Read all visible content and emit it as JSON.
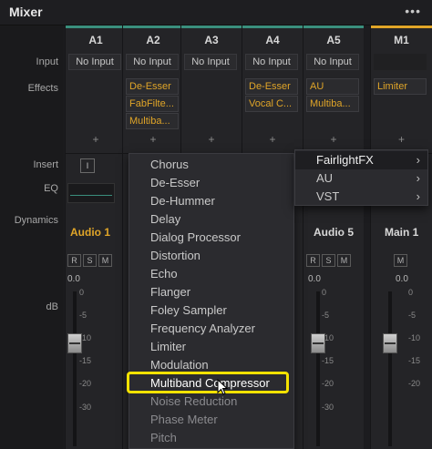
{
  "window": {
    "title": "Mixer",
    "more_menu": "•••"
  },
  "row_labels": {
    "input": "Input",
    "effects": "Effects",
    "insert": "Insert",
    "eq": "EQ",
    "dynamics": "Dynamics",
    "db": "dB"
  },
  "channels": [
    {
      "name": "A1",
      "input": "No Input",
      "effects": []
    },
    {
      "name": "A2",
      "input": "No Input",
      "effects": [
        "De-Esser",
        "FabFilte...",
        "Multiba..."
      ]
    },
    {
      "name": "A3",
      "input": "No Input",
      "effects": []
    },
    {
      "name": "A4",
      "input": "No Input",
      "effects": [
        "De-Esser",
        "Vocal C..."
      ]
    },
    {
      "name": "A5",
      "input": "No Input",
      "effects": [
        "AU",
        "Multiba..."
      ]
    },
    {
      "name": "M1",
      "input": "No Input",
      "effects": [
        "Limiter"
      ]
    }
  ],
  "add_effect_symbol": "+",
  "insert_button": "I",
  "track_names": {
    "audio1": "Audio 1",
    "audio5": "Audio 5",
    "main1": "Main 1"
  },
  "track_buttons": {
    "record": "R",
    "solo": "S",
    "mute": "M"
  },
  "gain_readout": "0.0",
  "db_scale": [
    "0",
    "-5",
    "-10",
    "-15",
    "-20",
    "-30"
  ],
  "plugin_menu": {
    "items": [
      "Chorus",
      "De-Esser",
      "De-Hummer",
      "Delay",
      "Dialog Processor",
      "Distortion",
      "Echo",
      "Flanger",
      "Foley Sampler",
      "Frequency Analyzer",
      "Limiter",
      "Modulation",
      "Multiband Compressor",
      "Noise Reduction",
      "Phase Meter",
      "Pitch"
    ],
    "highlighted": "Multiband Compressor"
  },
  "plugin_submenu": {
    "items": [
      "FairlightFX",
      "AU",
      "VST"
    ],
    "active": "FairlightFX",
    "arrow": "›"
  },
  "colors": {
    "accent_gold": "#e0a528",
    "channel_bar": "#3a8f7d",
    "highlight": "#f4e200"
  }
}
